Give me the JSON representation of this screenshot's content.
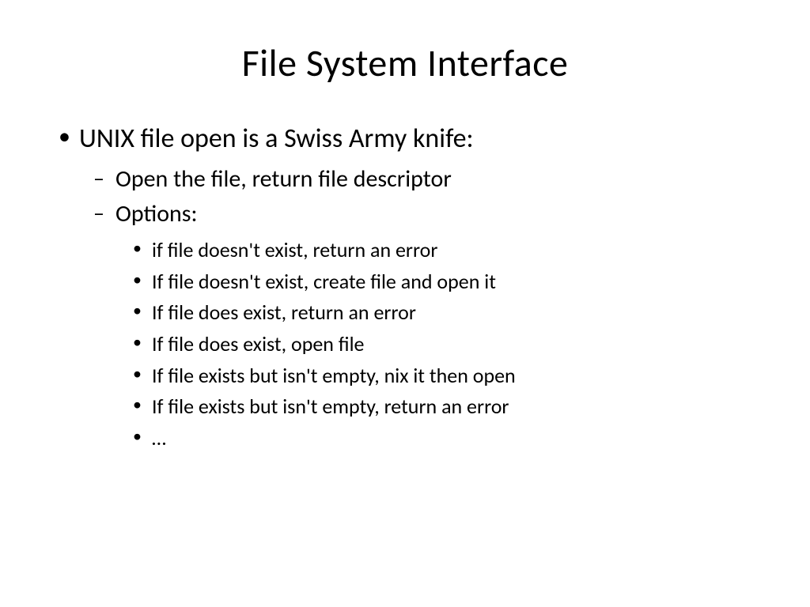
{
  "slide": {
    "title": "File System Interface",
    "bullets": {
      "l1": [
        {
          "text": "UNIX file open is a Swiss Army knife:",
          "l2": [
            {
              "text": "Open the file, return file descriptor"
            },
            {
              "text": "Options:",
              "l3": [
                "if file doesn't exist, return an error",
                "If file doesn't exist, create file and open it",
                "If file does exist, return an error",
                "If file does exist, open file",
                "If file exists but isn't empty, nix it then open",
                "If file exists but isn't empty, return an error",
                "…"
              ]
            }
          ]
        }
      ]
    }
  }
}
